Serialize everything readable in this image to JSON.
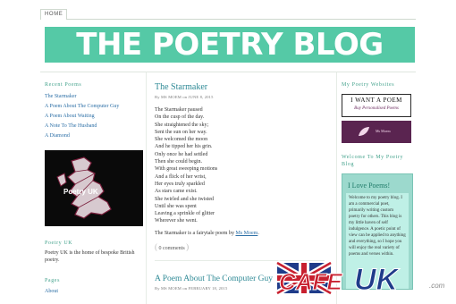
{
  "nav": {
    "home_tab": "HOME"
  },
  "banner": {
    "title": "THE POETRY BLOG",
    "bg_color": "#55c9a6"
  },
  "left_sidebar": {
    "recent_heading": "Recent Poems",
    "recent_items": [
      {
        "label": "The Starmaker"
      },
      {
        "label": "A Poem About The Computer Guy"
      },
      {
        "label": "A Poem About Waiting"
      },
      {
        "label": "A Note To The Husband"
      },
      {
        "label": "A Diamond"
      }
    ],
    "map_label": "Poetry UK",
    "blurb_heading": "Poetry UK",
    "blurb_text": "Poetry UK is the home of bespoke British poetry.",
    "pages_heading": "Pages",
    "pages_link": "About"
  },
  "main": {
    "post1": {
      "title": "The Starmaker",
      "meta": "By MS MOEM on JUNE 8, 2015",
      "lines": [
        "The Starmaker paused",
        "On the cusp of the day.",
        "She straightened the sky;",
        "Sent the sun on her way.",
        "She welcomed the moon",
        "And he tipped her his grin.",
        "Only once he had settled",
        "Then she could begin.",
        "With great sweeping motions",
        "And a flick of her wrist,",
        "Her eyes truly sparkled",
        "As stars came exist.",
        "She twirled and she twisted",
        "Until she was spent",
        "Leaving a sprinkle of glitter",
        "Wherever she went."
      ],
      "note_prefix": "The Starmaker is a fairytale poem by",
      "note_link": "Ms Moem",
      "note_suffix": ".",
      "comments_count": "0",
      "comments_label": "comments"
    },
    "post2": {
      "title": "A Poem About The Computer Guy",
      "meta": "By MS MOEM on FEBRUARY 18, 2015"
    }
  },
  "right_sidebar": {
    "websites_heading": "My Poetry Websites",
    "ad1_title": "I WANT A POEM",
    "ad1_sub": "Buy Personalised Poems",
    "ad2_label": "Ms Moem",
    "welcome_heading": "Welcome To My Poetry Blog",
    "welcome_box_title": "I Love Poems!",
    "welcome_body": "Welcome to my poetry blog. I am a commercial poet, primarily writing custom poetry for others. This blog is my little haven of self indulgence. A poetic point of view can be applied to anything and everything, so I hope you will enjoy the real variety of poems and verses within."
  },
  "watermark": {
    "text_part1": "CAFE",
    "text_part2": "UK",
    "suffix": ".com"
  }
}
